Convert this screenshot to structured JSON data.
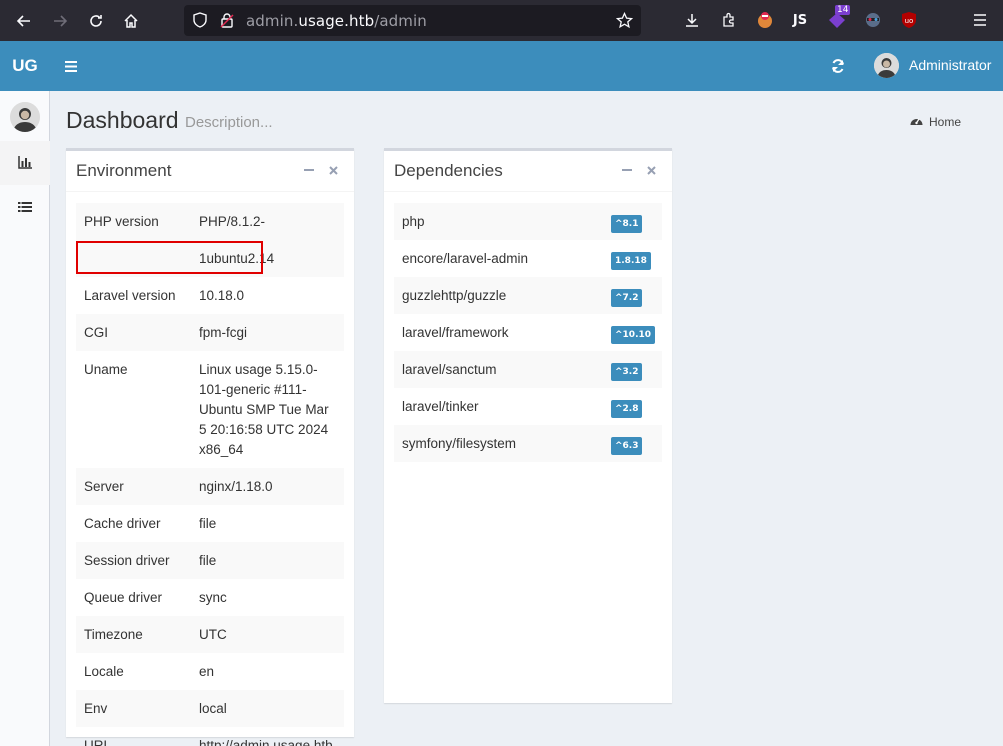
{
  "browser": {
    "url_prefix": "admin.",
    "url_domain": "usage.htb",
    "url_path": "/admin",
    "extension_badge": "14"
  },
  "header": {
    "logo": "UG",
    "user_name": "Administrator"
  },
  "page": {
    "title": "Dashboard",
    "description": "Description...",
    "breadcrumb": "Home"
  },
  "environment": {
    "title": "Environment",
    "rows": [
      {
        "key": "PHP version",
        "value": "PHP/8.1.2-1ubuntu2.14"
      },
      {
        "key": "Laravel version",
        "value": "10.18.0"
      },
      {
        "key": "CGI",
        "value": "fpm-fcgi"
      },
      {
        "key": "Uname",
        "value": "Linux usage 5.15.0-101-generic #111-Ubuntu SMP Tue Mar 5 20:16:58 UTC 2024 x86_64"
      },
      {
        "key": "Server",
        "value": "nginx/1.18.0"
      },
      {
        "key": "Cache driver",
        "value": "file"
      },
      {
        "key": "Session driver",
        "value": "file"
      },
      {
        "key": "Queue driver",
        "value": "sync"
      },
      {
        "key": "Timezone",
        "value": "UTC"
      },
      {
        "key": "Locale",
        "value": "en"
      },
      {
        "key": "Env",
        "value": "local"
      },
      {
        "key": "URL",
        "value": "http://admin.usage.htb"
      }
    ]
  },
  "dependencies": {
    "title": "Dependencies",
    "rows": [
      {
        "name": "php",
        "version": "^8.1"
      },
      {
        "name": "encore/laravel-admin",
        "version": "1.8.18"
      },
      {
        "name": "guzzlehttp/guzzle",
        "version": "^7.2"
      },
      {
        "name": "laravel/framework",
        "version": "^10.10"
      },
      {
        "name": "laravel/sanctum",
        "version": "^3.2"
      },
      {
        "name": "laravel/tinker",
        "version": "^2.8"
      },
      {
        "name": "symfony/filesystem",
        "version": "^6.3"
      }
    ]
  },
  "colors": {
    "header_blue": "#3c8dbc",
    "highlight_red": "#e00000"
  }
}
